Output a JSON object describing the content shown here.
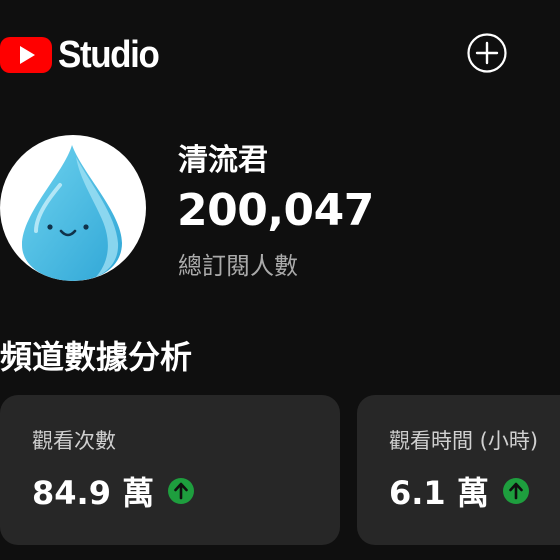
{
  "header": {
    "logo_text": "Studio",
    "brand_color": "#ff0000",
    "create_icon": "plus-circle-icon"
  },
  "channel": {
    "name": "清流君",
    "subscriber_count": "200,047",
    "subscriber_label": "總訂閱人數",
    "avatar_icon": "water-drop-icon"
  },
  "analytics": {
    "title": "頻道數據分析",
    "cards": [
      {
        "label": "觀看次數",
        "value": "84.9 萬",
        "trend": "up",
        "trend_icon": "arrow-up-icon",
        "trend_color": "#1e9e3e"
      },
      {
        "label": "觀看時間 (小時)",
        "value": "6.1 萬",
        "trend": "up",
        "trend_icon": "arrow-up-icon",
        "trend_color": "#1e9e3e"
      }
    ]
  },
  "colors": {
    "background": "#0f0f0f",
    "card_background": "#272727",
    "secondary_text": "#aaaaaa"
  }
}
